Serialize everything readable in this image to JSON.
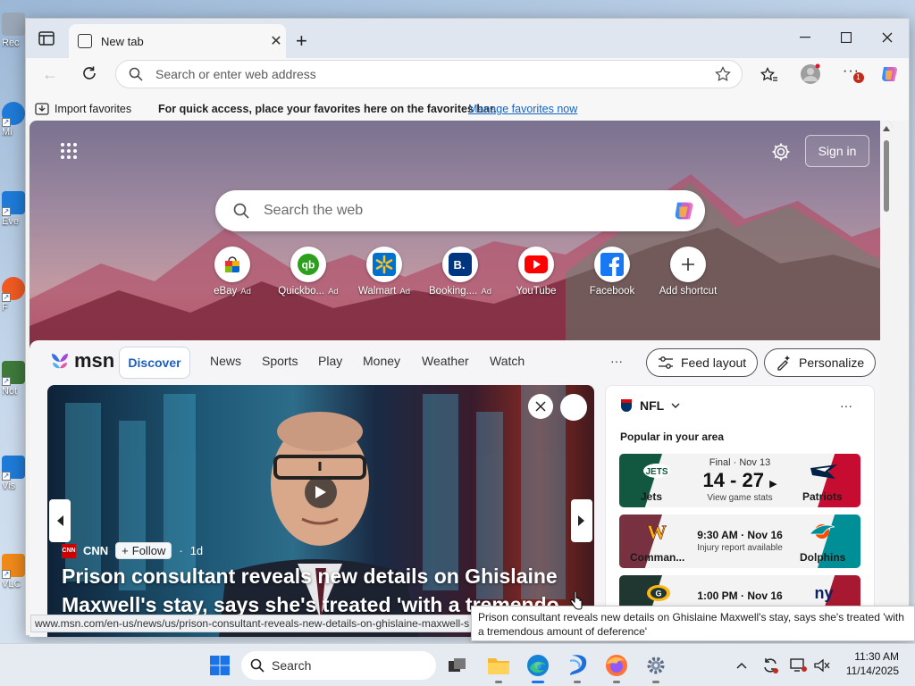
{
  "desktop": {
    "icons": [
      {
        "label": "Rec",
        "color": "#9aa7b6"
      },
      {
        "label": "Mi",
        "color": "#1e7bd8"
      },
      {
        "label": "Eve",
        "color": "#1e7bd8"
      },
      {
        "label": "F",
        "color": "#f05a22"
      },
      {
        "label": "Not",
        "color": "#3e7a3a"
      },
      {
        "label": "Vis",
        "color": "#1e7bd8"
      },
      {
        "label": "VLC",
        "color": "#f08a1a"
      }
    ]
  },
  "browser": {
    "tab_title": "New tab",
    "address_placeholder": "Search or enter web address",
    "notification_count": "1",
    "favorites_bar": {
      "import_label": "Import favorites",
      "message": "For quick access, place your favorites here on the favorites bar.",
      "manage_link": "Manage favorites now"
    }
  },
  "newtab": {
    "search_placeholder": "Search the web",
    "sign_in": "Sign in",
    "shortcuts": [
      {
        "name": "eBay",
        "ad": "Ad",
        "icon": "ebay-icon",
        "color": "#e53238"
      },
      {
        "name": "Quickbo...",
        "ad": "Ad",
        "icon": "quickbooks-icon",
        "color": "#2ca01c"
      },
      {
        "name": "Walmart",
        "ad": "Ad",
        "icon": "walmart-icon",
        "color": "#0071ce"
      },
      {
        "name": "Booking....",
        "ad": "Ad",
        "icon": "booking-icon",
        "color": "#003580"
      },
      {
        "name": "YouTube",
        "ad": "",
        "icon": "youtube-icon",
        "color": "#ff0000"
      },
      {
        "name": "Facebook",
        "ad": "",
        "icon": "facebook-icon",
        "color": "#1877f2"
      },
      {
        "name": "Add shortcut",
        "ad": "",
        "icon": "plus-icon",
        "color": "#333333"
      }
    ]
  },
  "feed": {
    "brand": "msn",
    "tabs": [
      "Discover",
      "News",
      "Sports",
      "Play",
      "Money",
      "Weather",
      "Watch"
    ],
    "more": "···",
    "feed_layout": "Feed layout",
    "personalize": "Personalize",
    "hero": {
      "source": "CNN",
      "follow": "Follow",
      "age": "1d",
      "headline_line1": "Prison consultant reveals new details on Ghislaine",
      "headline_line2": "Maxwell's stay, says she's treated 'with a tremendo"
    },
    "nfl": {
      "title": "NFL",
      "subtitle": "Popular in your area",
      "games": [
        {
          "status": "Final · Nov 13",
          "score": "14 - 27",
          "note": "View game stats",
          "home": "Jets",
          "away": "Patriots",
          "home_color": "#125740",
          "away_color": "#c60c30"
        },
        {
          "status": "9:30 AM · Nov 16",
          "score": "",
          "note": "Injury report available",
          "home": "Comman...",
          "away": "Dolphins",
          "home_color": "#773141",
          "away_color": "#008e97"
        },
        {
          "status": "1:00 PM · Nov 16",
          "score": "",
          "note": "",
          "home": "Packers",
          "away": "Giants",
          "home_color": "#203731",
          "away_color": "#a71930"
        }
      ]
    }
  },
  "status_url": "www.msn.com/en-us/news/us/prison-consultant-reveals-new-details-on-ghislaine-maxwell-s",
  "tooltip": "Prison consultant reveals new details on Ghislaine Maxwell's stay, says she's treated 'with a tremendous amount of deference'",
  "taskbar": {
    "search": "Search",
    "time": "11:30 AM",
    "date": "11/14/2025"
  }
}
